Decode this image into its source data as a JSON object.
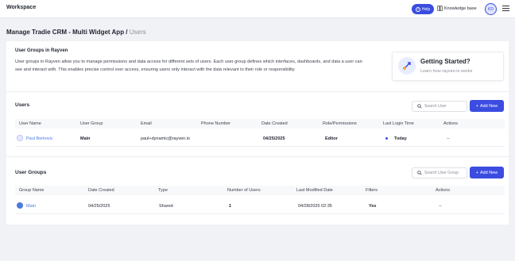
{
  "topbar": {
    "brand": "Workspace",
    "help_label": "Help",
    "knowledge_base_label": "Knowledge base",
    "avatar_initials": "KD"
  },
  "page": {
    "title": "Manage Tradie CRM - Multi Widget App /",
    "subtitle": "Users"
  },
  "intro": {
    "title": "User Groups in Rayven",
    "text": "User groups in Rayven allow you to manage permissions and data access for different sets of users. Each user group defines which interfaces, dashboards, and data a user can see and interact with. This enables precise control over access, ensuring users only interact with the data relevant to their role or responsibility."
  },
  "getting_started": {
    "title": "Getting Started?",
    "link": "Learn how rayven.io works"
  },
  "users": {
    "title": "Users",
    "search_placeholder": "Search User",
    "add_label": "Add New",
    "columns": [
      "User Name",
      "User Group",
      "Email",
      "Phone Number",
      "Date Created",
      "Role/Permissions",
      "Last Login Time",
      "Actions"
    ],
    "rows": [
      {
        "name": "Paul Berkovic",
        "group": "Main",
        "email": "paul+dynamic@rayven.io",
        "phone": "",
        "date_created": "04/25/2025",
        "role": "Editor",
        "last_login": "Today",
        "actions": "--"
      }
    ]
  },
  "user_groups": {
    "title": "User Groups",
    "search_placeholder": "Search User Group",
    "add_label": "Add New",
    "columns": [
      "Group Name",
      "Date Created",
      "Type",
      "Number of Users",
      "Last Modified Date",
      "Filters",
      "Actions"
    ],
    "rows": [
      {
        "name": "Main",
        "date_created": "04/25/2025",
        "type": "Shared",
        "num_users": "1",
        "last_modified": "04/28/2025 02:35",
        "filters": "Yes",
        "actions": "--"
      }
    ]
  },
  "colors": {
    "accent": "#3b4ce0",
    "link": "#4a7be0",
    "background": "#f0f2f5"
  }
}
